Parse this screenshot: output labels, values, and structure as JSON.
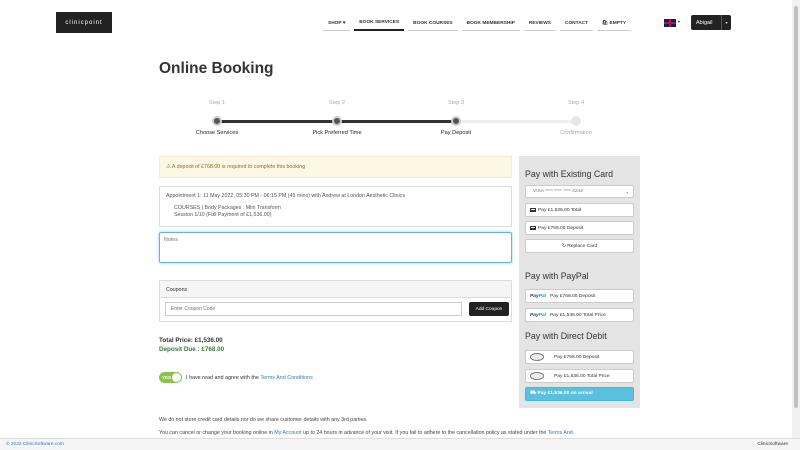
{
  "brand": {
    "logo": "clinicpoint"
  },
  "nav": {
    "items": [
      "SHOP ▾",
      "BOOK SERVICES",
      "BOOK COURSES",
      "BOOK MEMBERSHIP",
      "REVIEWS",
      "CONTACT",
      "🛍 EMPTY"
    ],
    "active_index": 1
  },
  "header": {
    "language_caret": "▾",
    "user_name": "Abigail",
    "user_caret": "▾"
  },
  "page": {
    "title": "Online Booking"
  },
  "steps": [
    {
      "label": "Step 1",
      "name": "Choose Services",
      "state": "done"
    },
    {
      "label": "Step 2",
      "name": "Pick Preferred Time",
      "state": "done"
    },
    {
      "label": "Step 3",
      "name": "Pay Deposit",
      "state": "done"
    },
    {
      "label": "Step 4",
      "name": "Confirmation",
      "state": "pending"
    }
  ],
  "alert": "⚠ A deposit of £768.00 is required to complete this booking",
  "appointment": {
    "line1": "Appointment 1:  11 May 2022, 05:30 PM - 06:15 PM (45 mins) with Andrew at London Aesthetic Clinics",
    "line2": "COURSES | Body Packages : Mini Transform",
    "line3": "Session 1/10 (Full Payment of £1,536.00)"
  },
  "notes": {
    "placeholder": "Notes"
  },
  "coupons": {
    "heading": "Coupons",
    "placeholder": "Enter Coupon Code",
    "button": "Add Coupon"
  },
  "totals": {
    "total": "Total Price: £1,536.00",
    "deposit": "Deposit Due : £768.00"
  },
  "agree": {
    "toggle": "YES",
    "text": "I have read and agree with the ",
    "link": "Terms And Conditions"
  },
  "info": {
    "line1": "We do not store credit card details nor do we share customer details with any 3rd parties.",
    "line2a": "You can cancel or change your booking online in ",
    "line2link": "My Account",
    "line2b": " up to 24 hours in advance of your visit. If you fail to adhere to the cancellation policy as stated under the ",
    "line2link2": "Terms And"
  },
  "payment": {
    "existing_title": "Pay with Existing Card",
    "card_select": "VISA **** **** **** 4242",
    "card_total": "Pay £1,536.00 Total",
    "card_deposit": "Pay £768.00 Deposit",
    "replace": "↻ Replace Card",
    "paypal_title": "Pay with PayPal",
    "paypal_deposit": "Pay £768.00 Deposit",
    "paypal_total": "Pay £1,536.00 Total Price",
    "paypal_logo_a": "Pay",
    "paypal_logo_b": "Pal",
    "dd_title": "Pay with Direct Debit",
    "dd_deposit": "Pay £768.00 Deposit",
    "dd_total": "Pay £1,536.00 Total Price",
    "arrival": "⛟ Pay £1,536.00 on arrival"
  },
  "footer": {
    "copyright": "© 2022 ClinicSoftware.com",
    "brand": "ClinicSoftware"
  }
}
